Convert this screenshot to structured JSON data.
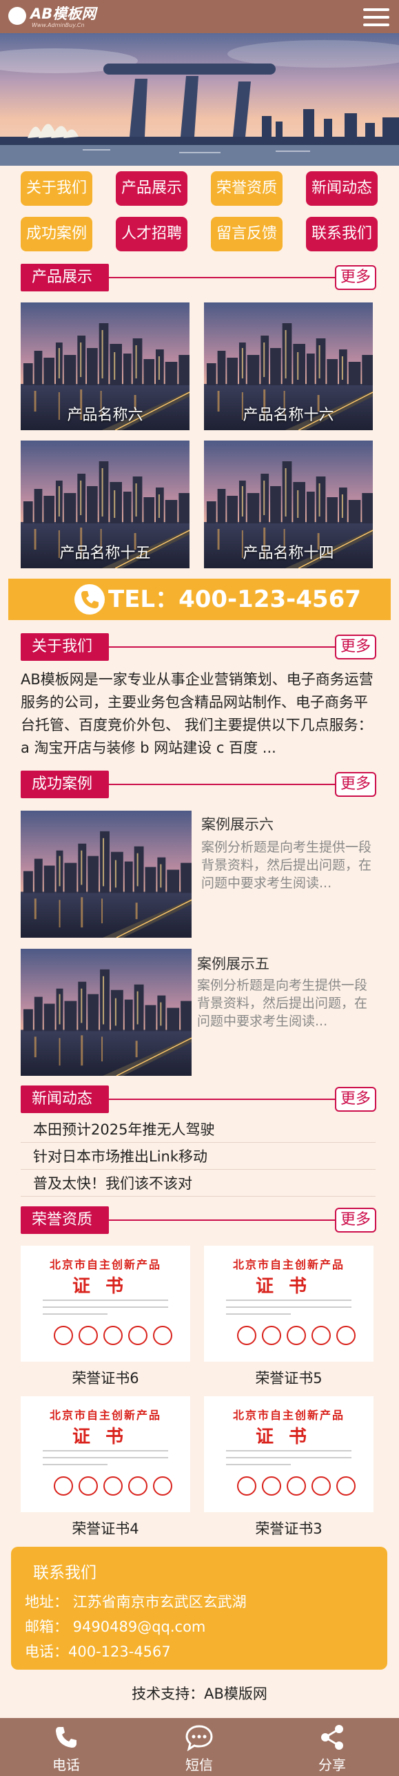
{
  "header": {
    "logo_text": "AB模板网",
    "logo_sub": "Www.AdminBuy.Cn",
    "menu_icon": "hamburger-menu-icon"
  },
  "nav": [
    {
      "label": "关于我们",
      "color": "#f6b22e"
    },
    {
      "label": "产品展示",
      "color": "#d0124a"
    },
    {
      "label": "荣誉资质",
      "color": "#f6b22e"
    },
    {
      "label": "新闻动态",
      "color": "#d0124a"
    },
    {
      "label": "成功案例",
      "color": "#f6b22e"
    },
    {
      "label": "人才招聘",
      "color": "#d0124a"
    },
    {
      "label": "留言反馈",
      "color": "#f6b22e"
    },
    {
      "label": "联系我们",
      "color": "#d0124a"
    }
  ],
  "more_label": "更多",
  "products": {
    "title": "产品展示",
    "items": [
      "产品名称六",
      "产品名称十六",
      "产品名称十五",
      "产品名称十四"
    ]
  },
  "tel": {
    "text": "TEL：400-123-4567",
    "icon": "phone-icon"
  },
  "about": {
    "title": "关于我们",
    "text": "AB模板网是一家专业从事企业营销策划、电子商务运营服务的公司，主要业务包含精品网站制作、电子商务平台托管、百度竞价外包、 我们主要提供以下几点服务： a 淘宝开店与装修 b 网站建设 c 百度 ..."
  },
  "cases": {
    "title": "成功案例",
    "items": [
      {
        "title": "案例展示六",
        "desc": "案例分析题是向考生提供一段背景资料，然后提出问题，在问题中要求考生阅读..."
      },
      {
        "title": "案例展示五",
        "desc": "案例分析题是向考生提供一段背景资料，然后提出问题，在问题中要求考生阅读..."
      }
    ]
  },
  "news": {
    "title": "新闻动态",
    "items": [
      "本田预计2025年推无人驾驶",
      "针对日本市场推出Link移动",
      "普及太快！我们该不该对"
    ]
  },
  "honors": {
    "title": "荣誉资质",
    "cert_title": "北京市自主创新产品",
    "cert_word": "证书",
    "items": [
      "荣誉证书6",
      "荣誉证书5",
      "荣誉证书4",
      "荣誉证书3"
    ]
  },
  "contact": {
    "title": "联系我们",
    "address": "地址：  江苏省南京市玄武区玄武湖",
    "email": "邮箱：  9490489@qq.com",
    "phone": "电话：400-123-4567"
  },
  "support": "技术支持：AB模版网",
  "footer": [
    {
      "label": "电话",
      "icon": "phone-icon"
    },
    {
      "label": "短信",
      "icon": "chat-bubble-icon"
    },
    {
      "label": "分享",
      "icon": "share-icon"
    }
  ],
  "colors": {
    "primary_red": "#cc0e4b",
    "accent_yellow": "#f6b22e",
    "header_brown": "#9f6a59",
    "background": "#fdf0e6"
  }
}
